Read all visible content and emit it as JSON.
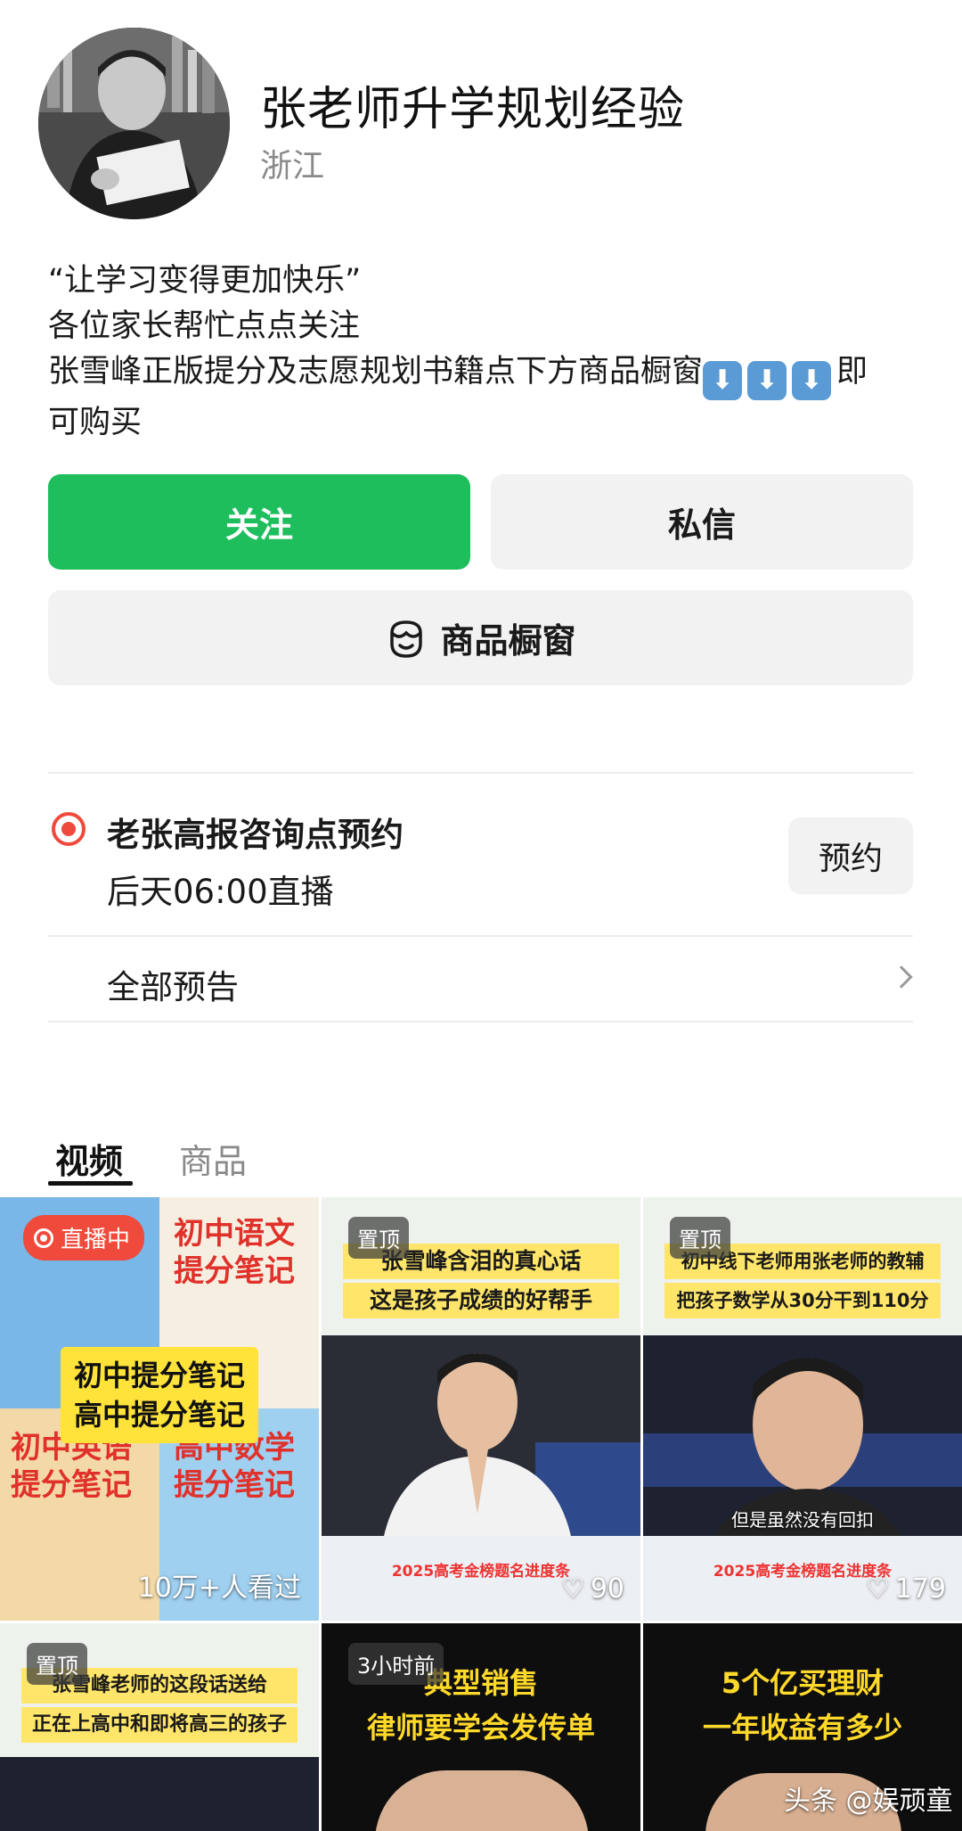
{
  "profile": {
    "name": "张老师升学规划经验",
    "region": "浙江",
    "bio_lines": [
      "“让学习变得更加快乐”",
      "各位家长帮忙点点关注",
      "张雪峰正版提分及志愿规划书籍点下方商品橱窗"
    ],
    "bio_tail": "即",
    "bio_last": "可购买",
    "bio_arrow": "⬇"
  },
  "actions": {
    "follow": "关注",
    "message": "私信",
    "shop": "商品橱窗",
    "follow_color": "#1ebe5d"
  },
  "live": {
    "title": "老张高报咨询点预约",
    "time": "后天06:00直播",
    "reserve": "预约",
    "all_preview": "全部预告"
  },
  "tabs": [
    {
      "label": "视频",
      "active": true
    },
    {
      "label": "商品",
      "active": false
    }
  ],
  "videos": [
    {
      "badge": "直播中",
      "banner": [
        "初中提分笔记",
        "高中提分笔记"
      ],
      "book_titles": [
        "初中语文",
        "提分笔记",
        "初中英语",
        "提分笔记",
        "高中数学",
        "提分笔记"
      ],
      "stat": "10万+人看过"
    },
    {
      "badge": "置顶",
      "captions": [
        "张雪峰含泪的真心话",
        "这是孩子成绩的好帮手"
      ],
      "footer": "2025高考金榜题名进度条",
      "likes": "90"
    },
    {
      "badge": "置顶",
      "captions": [
        "初中线下老师用张老师的教辅",
        "把孩子数学从30分干到110分"
      ],
      "subtitle": "但是虽然没有回扣",
      "footer": "2025高考金榜题名进度条",
      "likes": "179"
    },
    {
      "badge": "置顶",
      "captions": [
        "张雪峰老师的这段话送给",
        "正在上高中和即将高三的孩子"
      ]
    },
    {
      "badge": "3小时前",
      "titles": [
        "典型销售",
        "律师要学会发传单"
      ]
    },
    {
      "titles": [
        "5个亿买理财",
        "一年收益有多少"
      ]
    }
  ],
  "watermark": "头条 @娱顽童"
}
